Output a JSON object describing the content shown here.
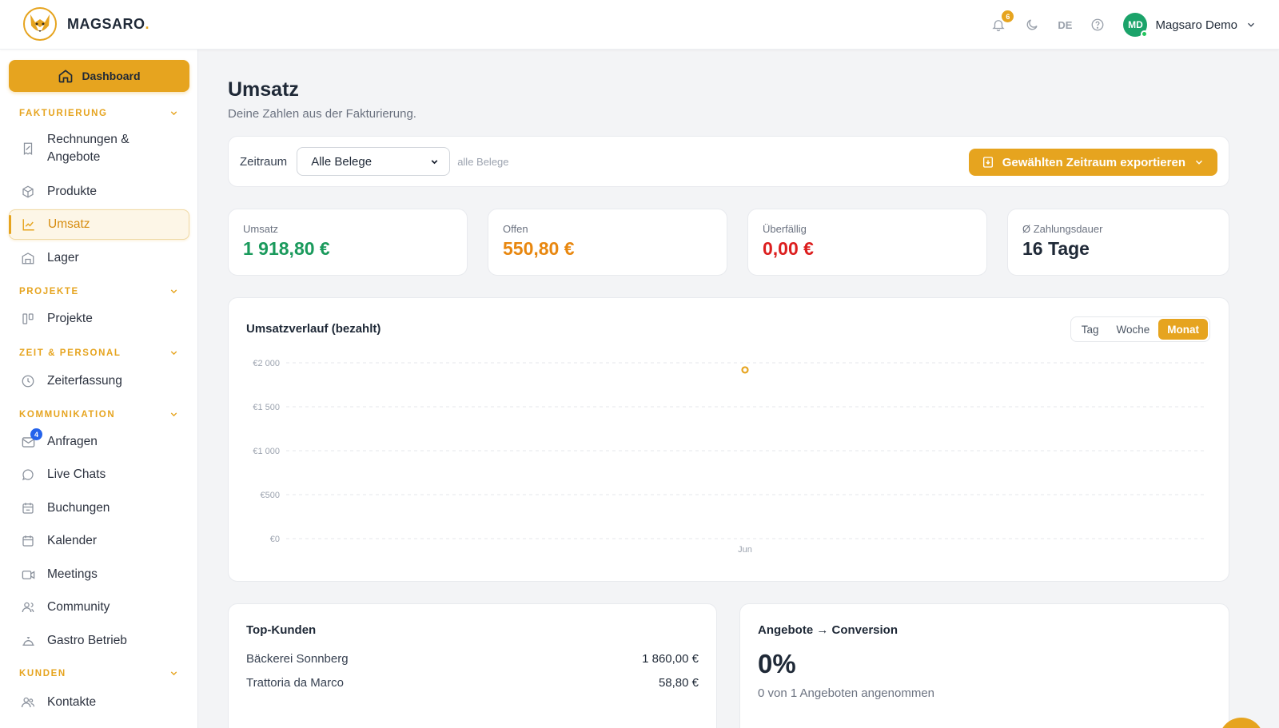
{
  "header": {
    "brand": "MAGSARO",
    "brand_suffix": ".",
    "notifications_count": "6",
    "language": "DE",
    "user_initials": "MD",
    "user_name": "Magsaro Demo"
  },
  "sidebar": {
    "dashboard": "Dashboard",
    "sections": {
      "fakturierung": "FAKTURIERUNG",
      "projekte": "PROJEKTE",
      "zeit": "ZEIT & PERSONAL",
      "kommunikation": "KOMMUNIKATION",
      "kunden": "KUNDEN"
    },
    "items": {
      "rechnungen": "Rechnungen & Angebote",
      "produkte": "Produkte",
      "umsatz": "Umsatz",
      "lager": "Lager",
      "projekte": "Projekte",
      "zeiterfassung": "Zeiterfassung",
      "anfragen": "Anfragen",
      "anfragen_badge": "4",
      "live_chats": "Live Chats",
      "buchungen": "Buchungen",
      "kalender": "Kalender",
      "meetings": "Meetings",
      "community": "Community",
      "gastro": "Gastro Betrieb",
      "kontakte": "Kontakte"
    }
  },
  "main": {
    "title": "Umsatz",
    "subtitle": "Deine Zahlen aus der Fakturierung.",
    "filter": {
      "label": "Zeitraum",
      "selected": "Alle Belege",
      "note": "alle Belege",
      "export_label": "Gewählten Zeitraum exportieren"
    },
    "kpis": [
      {
        "label": "Umsatz",
        "value": "1 918,80 €",
        "color": "#1a9a5c"
      },
      {
        "label": "Offen",
        "value": "550,80 €",
        "color": "#e8870f"
      },
      {
        "label": "Überfällig",
        "value": "0,00 €",
        "color": "#dc1e1e"
      },
      {
        "label": "Ø Zahlungsdauer",
        "value": "16 Tage",
        "color": "#1f2937"
      }
    ],
    "chart": {
      "title": "Umsatzverlauf (bezahlt)",
      "toggle": {
        "day": "Tag",
        "week": "Woche",
        "month": "Monat",
        "active": "Monat"
      }
    },
    "top_customers": {
      "title": "Top-Kunden",
      "rows": [
        {
          "name": "Bäckerei Sonnberg",
          "amount": "1 860,00 €"
        },
        {
          "name": "Trattoria da Marco",
          "amount": "58,80 €"
        }
      ]
    },
    "conversion": {
      "title": "Angebote → Conversion",
      "value": "0%",
      "note": "0 von 1 Angeboten angenommen"
    }
  },
  "chart_data": {
    "type": "line",
    "title": "Umsatzverlauf (bezahlt)",
    "categories": [
      "Jun"
    ],
    "series": [
      {
        "values": [
          1918.8
        ]
      }
    ],
    "yticks": [
      "€0",
      "€500",
      "€1 000",
      "€1 500",
      "€2 000"
    ],
    "ytick_values": [
      0,
      500,
      1000,
      1500,
      2000
    ],
    "ylim": [
      0,
      2000
    ],
    "grid": true,
    "color": "#e6a41f"
  }
}
